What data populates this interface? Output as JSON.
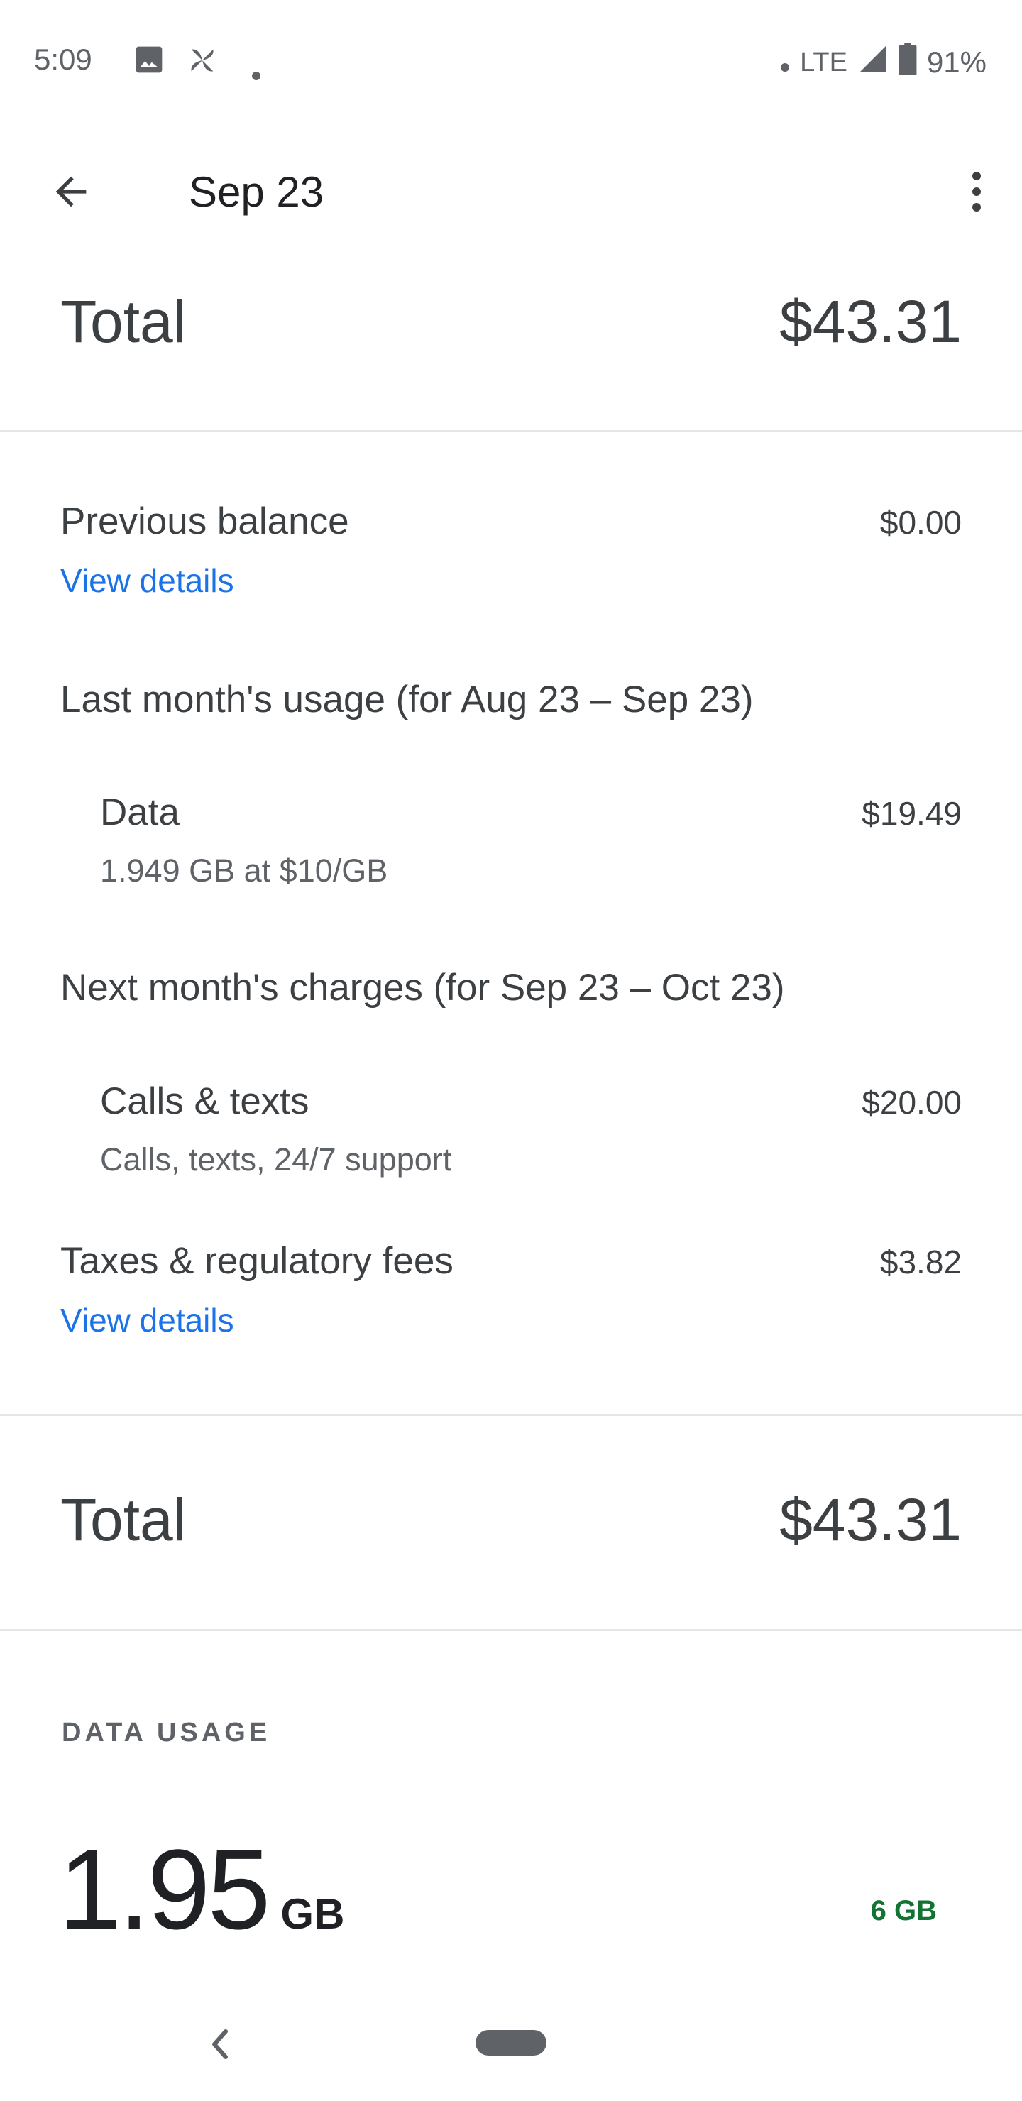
{
  "status_bar": {
    "time": "5:09",
    "network": "LTE",
    "battery": "91%",
    "icons": [
      "image-icon",
      "pinwheel-icon",
      "dot-icon",
      "dot-icon",
      "signal-icon",
      "battery-icon"
    ]
  },
  "app_bar": {
    "title": "Sep 23",
    "icons": [
      "arrow-back-icon",
      "more-vert-icon"
    ]
  },
  "summary": {
    "total_label": "Total",
    "total_value": "$43.31"
  },
  "items": {
    "previous_balance": {
      "label": "Previous balance",
      "value": "$0.00",
      "link": "View details"
    },
    "last_month_heading": "Last month's usage (for Aug 23 – Sep 23)",
    "data": {
      "label": "Data",
      "value": "$19.49",
      "desc": "1.949 GB at $10/GB"
    },
    "next_month_heading": "Next month's charges (for Sep 23 – Oct 23)",
    "calls": {
      "label": "Calls & texts",
      "value": "$20.00",
      "desc": "Calls, texts, 24/7 support"
    },
    "taxes": {
      "label": "Taxes & regulatory fees",
      "value": "$3.82",
      "link": "View details"
    }
  },
  "bottom_total": {
    "label": "Total",
    "value": "$43.31"
  },
  "data_usage": {
    "heading": "DATA USAGE",
    "amount": "1.95",
    "unit": "GB",
    "limit": "6 GB"
  },
  "colors": {
    "link": "#1a73e8",
    "limit": "#137333",
    "text": "#3c4043",
    "secondary": "#5f6368"
  }
}
